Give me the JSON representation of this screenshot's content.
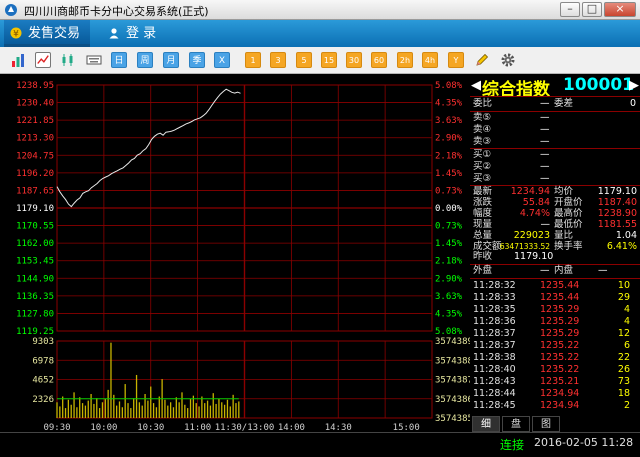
{
  "window": {
    "title": "四川川商邮币卡分中心交易系统(正式)",
    "minimize": "–",
    "maximize": "□",
    "close": "×"
  },
  "nav": {
    "tabs": [
      {
        "label": "发售交易",
        "icon": "yen-icon"
      },
      {
        "label": "登  录",
        "icon": "user-icon"
      }
    ]
  },
  "toolbar": {
    "buttons": [
      "bar-chart-icon",
      "line-chart-icon",
      "candle-chart-icon",
      "keyboard-icon"
    ],
    "periods": [
      "日",
      "周",
      "月",
      "季",
      "X"
    ],
    "minutes": [
      "1",
      "3",
      "5",
      "15",
      "30",
      "60",
      "2h",
      "4h",
      "Y"
    ],
    "extra": [
      "pencil-icon",
      "gear-icon"
    ]
  },
  "chart_data": {
    "type": "line",
    "title": "",
    "prev_close": 1179.1,
    "price_ticks": [
      "1238.95",
      "1230.40",
      "1221.85",
      "1213.30",
      "1204.75",
      "1196.20",
      "1187.65",
      "1179.10",
      "1170.55",
      "1162.00",
      "1153.45",
      "1144.90",
      "1136.35",
      "1127.80",
      "1119.25"
    ],
    "pct_ticks": [
      "5.08%",
      "4.35%",
      "3.63%",
      "2.90%",
      "2.18%",
      "1.45%",
      "0.73%",
      "0.00%",
      "0.73%",
      "1.45%",
      "2.18%",
      "2.90%",
      "3.63%",
      "4.35%",
      "5.08%"
    ],
    "ylim": [
      1119.25,
      1238.95
    ],
    "volume_ticks": [
      "9303",
      "6978",
      "4652",
      "2326"
    ],
    "amount_ticks": [
      "3574389",
      "3574388",
      "3574387",
      "3574386",
      "3574385"
    ],
    "time_labels": [
      "09:30",
      "10:00",
      "10:30",
      "11:00",
      "11:30/13:00",
      "14:00",
      "14:30",
      "15:00"
    ],
    "price_series": [
      [
        0,
        1189.5
      ],
      [
        1,
        1187.0
      ],
      [
        2,
        1185.0
      ],
      [
        3,
        1183.2
      ],
      [
        4,
        1181.0
      ],
      [
        5,
        1179.8
      ],
      [
        6,
        1181.5
      ],
      [
        7,
        1183.0
      ],
      [
        8,
        1184.0
      ],
      [
        9,
        1186.2
      ],
      [
        10,
        1187.0
      ],
      [
        11,
        1187.5
      ],
      [
        12,
        1189.0
      ],
      [
        13,
        1190.0
      ],
      [
        14,
        1191.0
      ],
      [
        15,
        1192.5
      ],
      [
        16,
        1193.5
      ],
      [
        17,
        1194.2
      ],
      [
        18,
        1194.8
      ],
      [
        19,
        1195.8
      ],
      [
        20,
        1196.5
      ],
      [
        21,
        1197.2
      ],
      [
        22,
        1198.0
      ],
      [
        23,
        1198.6
      ],
      [
        24,
        1199.8
      ],
      [
        25,
        1201.0
      ],
      [
        26,
        1202.5
      ],
      [
        27,
        1203.2
      ],
      [
        28,
        1204.8
      ],
      [
        29,
        1205.5
      ],
      [
        30,
        1207.0
      ],
      [
        31,
        1208.0
      ],
      [
        32,
        1210.0
      ],
      [
        33,
        1212.5
      ],
      [
        34,
        1214.0
      ],
      [
        35,
        1215.0
      ],
      [
        36,
        1215.5
      ],
      [
        37,
        1214.5
      ],
      [
        38,
        1216.0
      ],
      [
        39,
        1216.2
      ],
      [
        40,
        1216.5
      ],
      [
        41,
        1217.0
      ],
      [
        42,
        1217.8
      ],
      [
        43,
        1218.5
      ],
      [
        44,
        1219.2
      ],
      [
        45,
        1220.0
      ],
      [
        46,
        1220.5
      ],
      [
        47,
        1221.2
      ],
      [
        48,
        1222.0
      ],
      [
        49,
        1222.5
      ],
      [
        50,
        1223.0
      ],
      [
        51,
        1224.0
      ],
      [
        52,
        1225.2
      ],
      [
        53,
        1227.0
      ],
      [
        54,
        1229.0
      ],
      [
        55,
        1231.0
      ],
      [
        56,
        1232.8
      ],
      [
        57,
        1234.5
      ],
      [
        58,
        1235.8
      ],
      [
        59,
        1236.9
      ],
      [
        60,
        1236.2
      ],
      [
        61,
        1235.4
      ],
      [
        62,
        1235.0
      ],
      [
        63,
        1235.5
      ],
      [
        64,
        1234.9
      ]
    ],
    "volume_series": [
      1900,
      1400,
      2600,
      1200,
      2200,
      1600,
      3100,
      1300,
      2500,
      1800,
      1500,
      2100,
      2900,
      1700,
      2400,
      1200,
      1900,
      2300,
      3400,
      9100,
      2800,
      1500,
      2000,
      1300,
      4100,
      1800,
      1200,
      2400,
      5200,
      1900,
      1500,
      2900,
      2100,
      3800,
      1800,
      1300,
      2600,
      4700,
      2200,
      1500,
      1900,
      1300,
      2500,
      1900,
      3100,
      1600,
      1200,
      2300,
      2700,
      1800,
      1400,
      2600,
      1800,
      2100,
      1500,
      3000,
      1700,
      2300,
      1900,
      1600,
      2200,
      1400,
      2800,
      1800,
      2000
    ],
    "volume_avg": 2326
  },
  "panel": {
    "name": "综合指数",
    "code": "100001",
    "weibi_label": "委比",
    "weibi_value": "—",
    "weicha_label": "委差",
    "weicha_value": "0",
    "asks": [
      {
        "label": "卖⑤",
        "price": "—"
      },
      {
        "label": "卖④",
        "price": "—"
      },
      {
        "label": "卖③",
        "price": "—"
      }
    ],
    "bids": [
      {
        "label": "买①",
        "price": "—"
      },
      {
        "label": "买②",
        "price": "—"
      },
      {
        "label": "买③",
        "price": "—"
      }
    ],
    "stats": [
      {
        "l1": "最新",
        "v1": "1234.94",
        "l2": "均价",
        "v2": "1179.10",
        "c1": "#ff3030",
        "c2": "#ffffff"
      },
      {
        "l1": "涨跌",
        "v1": "55.84",
        "l2": "开盘价",
        "v2": "1187.40",
        "c1": "#ff3030",
        "c2": "#ff3030"
      },
      {
        "l1": "幅度",
        "v1": "4.74%",
        "l2": "最高价",
        "v2": "1238.90",
        "c1": "#ff3030",
        "c2": "#ff3030"
      },
      {
        "l1": "现量",
        "v1": "—",
        "l2": "最低价",
        "v2": "1181.55",
        "c1": "#ffffff",
        "c2": "#ff3030"
      },
      {
        "l1": "总量",
        "v1": "229023",
        "l2": "量比",
        "v2": "1.04",
        "c1": "#ffff00",
        "c2": "#ffffff"
      },
      {
        "l1": "成交额",
        "v1": "63471333.52",
        "l2": "换手率",
        "v2": "6.41%",
        "c1": "#ffff00",
        "c2": "#ffff00"
      }
    ],
    "zuoshou_label": "昨收",
    "zuoshou_value": "1179.10",
    "waipan_label": "外盘",
    "waipan_value": "—",
    "neipan_label": "内盘",
    "neipan_value": "—",
    "ticks": [
      {
        "time": "11:28:32",
        "price": "1235.44",
        "vol": "10"
      },
      {
        "time": "11:28:33",
        "price": "1235.44",
        "vol": "29"
      },
      {
        "time": "11:28:35",
        "price": "1235.29",
        "vol": "4"
      },
      {
        "time": "11:28:36",
        "price": "1235.29",
        "vol": "4"
      },
      {
        "time": "11:28:37",
        "price": "1235.29",
        "vol": "12"
      },
      {
        "time": "11:28:37",
        "price": "1235.22",
        "vol": "6"
      },
      {
        "time": "11:28:38",
        "price": "1235.22",
        "vol": "22"
      },
      {
        "time": "11:28:40",
        "price": "1235.22",
        "vol": "26"
      },
      {
        "time": "11:28:43",
        "price": "1235.21",
        "vol": "73"
      },
      {
        "time": "11:28:44",
        "price": "1234.94",
        "vol": "18"
      },
      {
        "time": "11:28:45",
        "price": "1234.94",
        "vol": "2"
      }
    ],
    "tabs": [
      "细",
      "盘",
      "图"
    ]
  },
  "status": {
    "connection": "连接",
    "datetime": "2016-02-05 11:28"
  },
  "colors": {
    "grid": "#8b0000",
    "up": "#ff3030",
    "down": "#00ff00",
    "flat": "#ffffff",
    "price_line": "#e8e8e8",
    "vol_bar": "#c8b400",
    "vol_avg": "#00cc00"
  }
}
